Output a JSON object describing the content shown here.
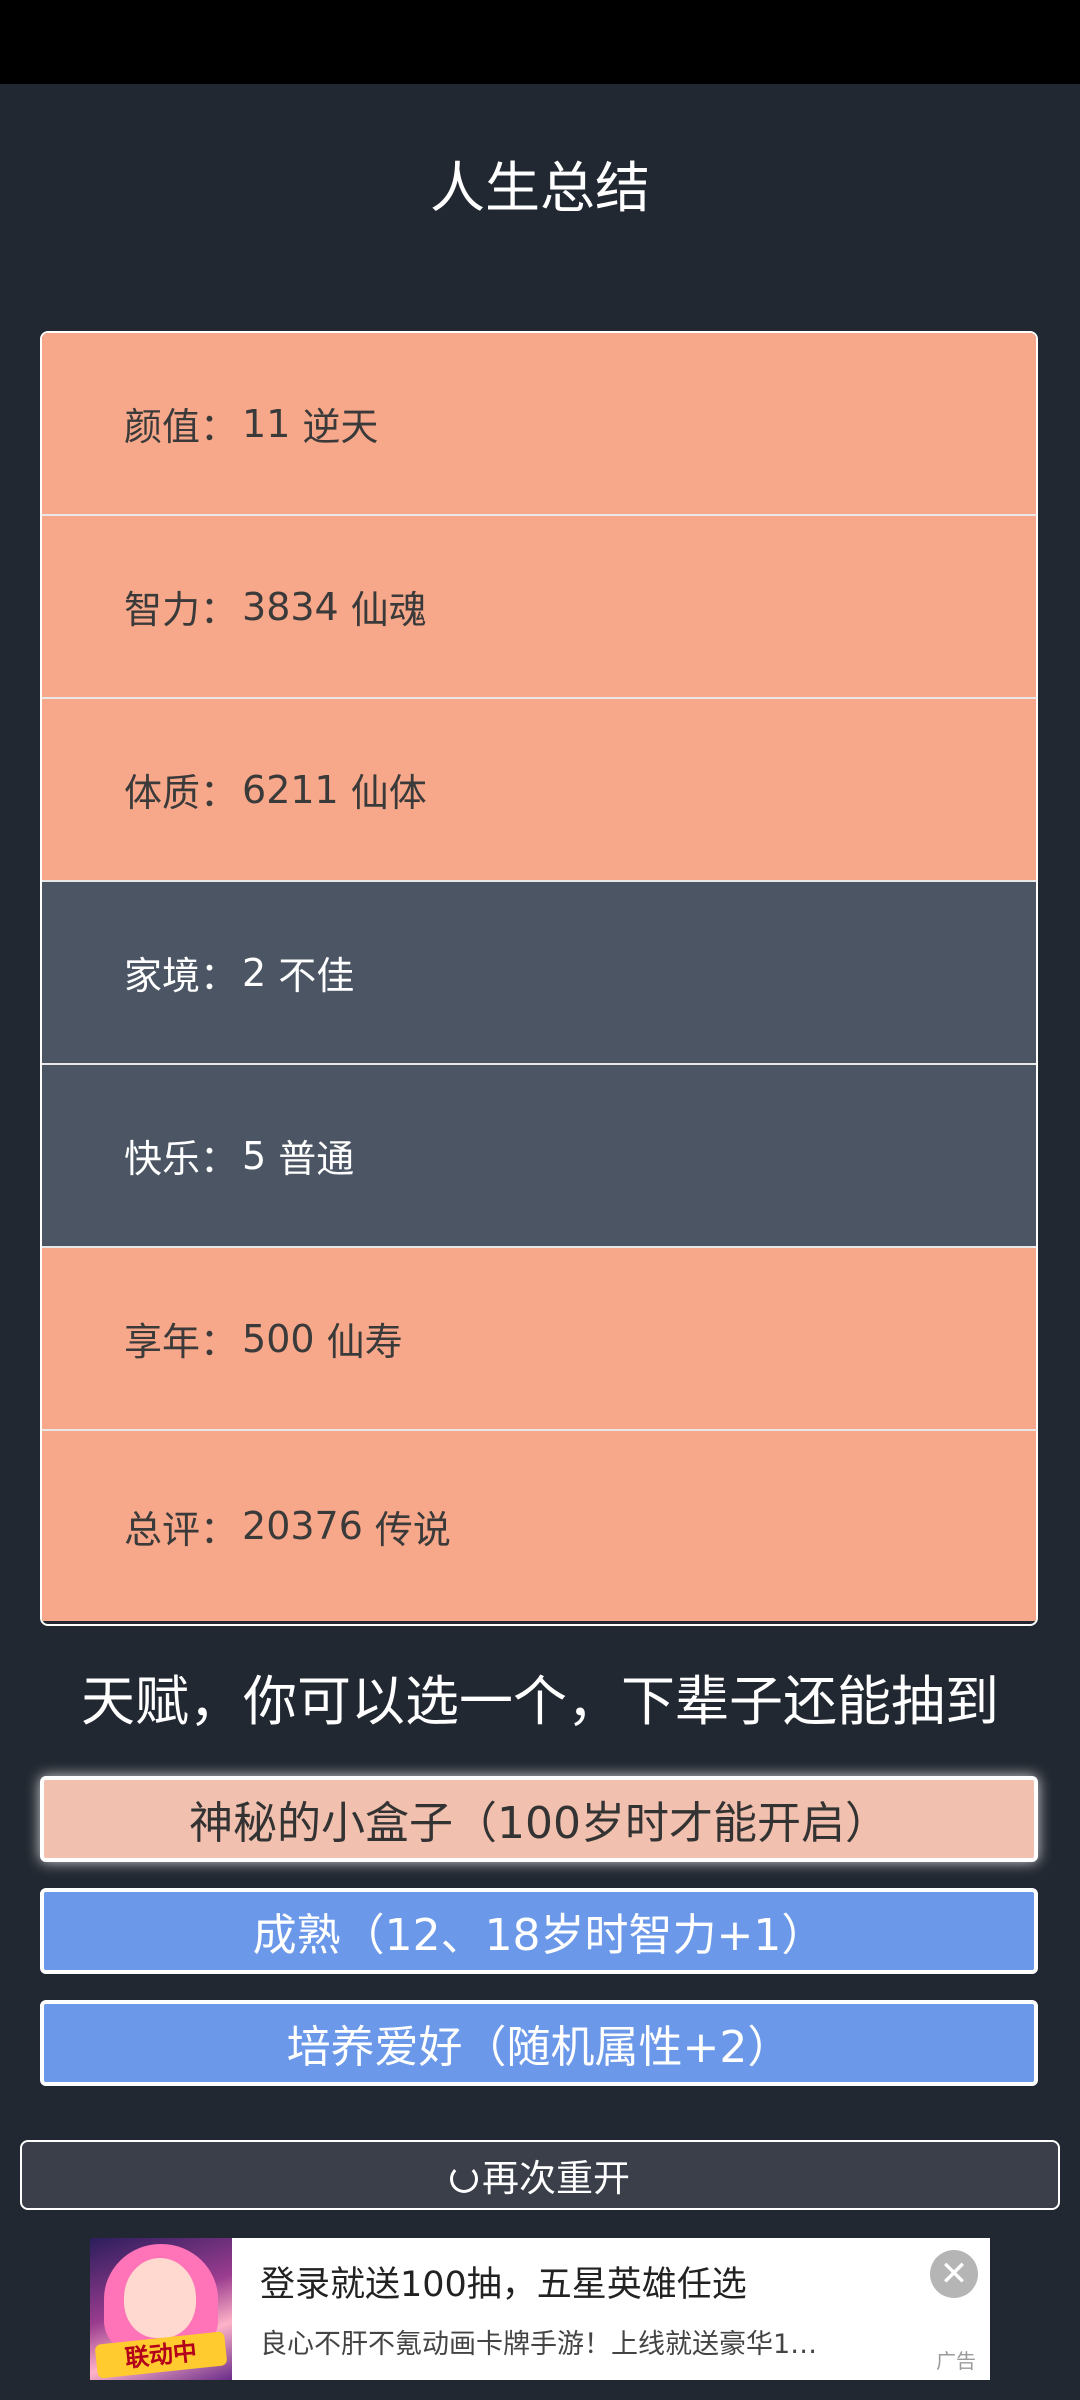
{
  "title": "人生总结",
  "summary": {
    "separator": "：",
    "rows": [
      {
        "label": "颜值",
        "value": "11",
        "grade": "逆天"
      },
      {
        "label": "智力",
        "value": "3834",
        "grade": "仙魂"
      },
      {
        "label": "体质",
        "value": "6211",
        "grade": "仙体"
      },
      {
        "label": "家境",
        "value": "2",
        "grade": "不佳"
      },
      {
        "label": "快乐",
        "value": "5",
        "grade": "普通"
      },
      {
        "label": "享年",
        "value": "500",
        "grade": "仙寿"
      },
      {
        "label": "总评",
        "value": "20376",
        "grade": "传说"
      }
    ]
  },
  "talents": {
    "prompt": "天赋，你可以选一个，下辈子还能抽到",
    "items": [
      {
        "label": "神秘的小盒子（100岁时才能开启）",
        "selected": true
      },
      {
        "label": "成熟（12、18岁时智力+1）",
        "selected": false
      },
      {
        "label": "培养爱好（随机属性+2）",
        "selected": false
      }
    ]
  },
  "restart": {
    "label": "再次重开",
    "icon": "refresh-icon"
  },
  "ad": {
    "headline": "登录就送100抽，五星英雄任选",
    "description": "良心不肝不氪动画卡牌手游！上线就送豪华1…",
    "image_badge": "联动中",
    "close_icon": "close-icon",
    "tag": "广告"
  },
  "colors": {
    "background": "#222831",
    "row_highlight": "#f7a88a",
    "row_muted": "#4b5563",
    "talent_selected": "#f2c0ae",
    "talent_normal": "#6b98e8"
  }
}
